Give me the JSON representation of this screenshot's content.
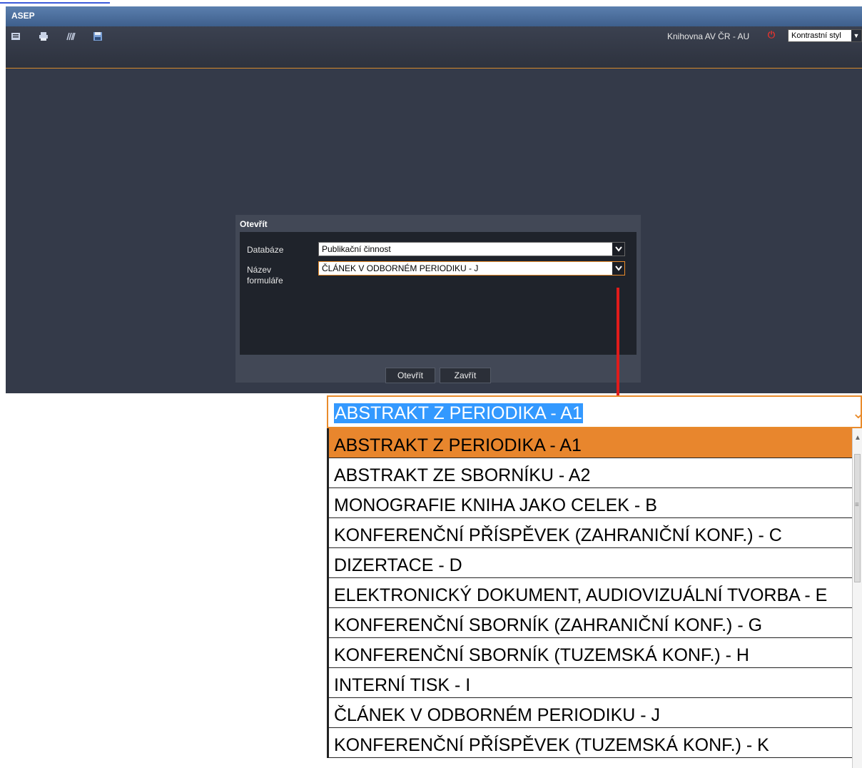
{
  "app": {
    "title": "ASEP",
    "library_label": "Knihovna AV ČR - AU",
    "style_select": "Kontrastní styl"
  },
  "toolbar": {
    "icons": [
      "list-icon",
      "print-icon",
      "barcode-icon",
      "save-icon"
    ]
  },
  "dialog": {
    "title": "Otevřít",
    "database_label": "Databáze",
    "database_value": "Publikační činnost",
    "form_label_line1": "Název",
    "form_label_line2": "formuláře",
    "form_value": "ČLÁNEK V ODBORNÉM PERIODIKU - J",
    "open_button": "Otevřít",
    "close_button": "Zavřít"
  },
  "dropdown": {
    "selected_text": "ABSTRAKT Z PERIODIKA - A1",
    "items": [
      "ABSTRAKT Z PERIODIKA - A1",
      "ABSTRAKT ZE SBORNÍKU - A2",
      "MONOGRAFIE KNIHA JAKO CELEK - B",
      "KONFERENČNÍ PŘÍSPĚVEK (ZAHRANIČNÍ KONF.) - C",
      "DIZERTACE - D",
      "ELEKTRONICKÝ DOKUMENT, AUDIOVIZUÁLNÍ TVORBA - E",
      "KONFERENČNÍ SBORNÍK (ZAHRANIČNÍ KONF.) - G",
      "KONFERENČNÍ SBORNÍK (TUZEMSKÁ KONF.) - H",
      "INTERNÍ TISK - I",
      "ČLÁNEK V ODBORNÉM PERIODIKU - J",
      "KONFERENČNÍ PŘÍSPĚVEK (TUZEMSKÁ KONF.) - K"
    ],
    "highlighted_index": 0
  },
  "colors": {
    "accent_orange": "#e8862d",
    "selection_blue": "#3399ff",
    "annotation_red": "#e01b1b"
  }
}
